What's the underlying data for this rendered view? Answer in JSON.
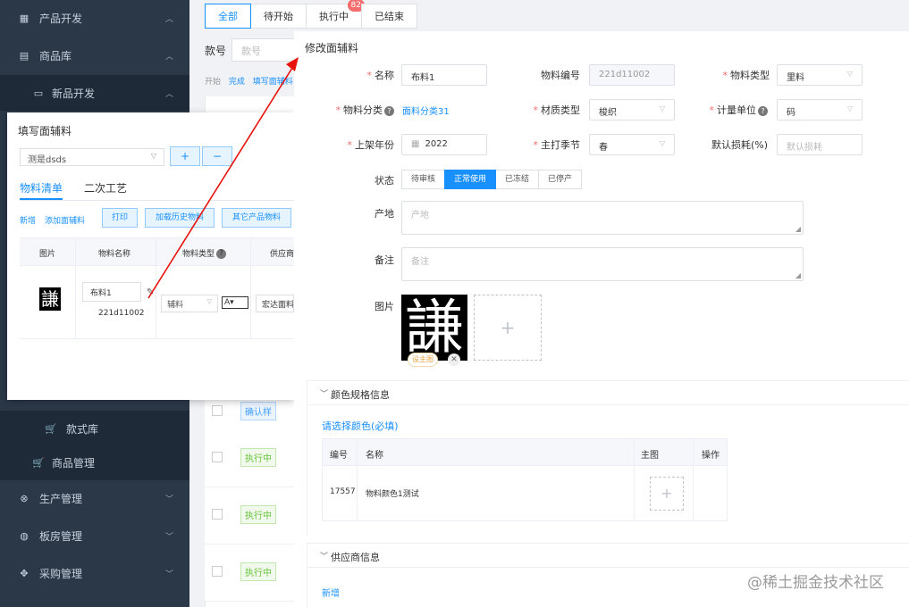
{
  "sidebar": {
    "items": [
      {
        "label": "产品开发",
        "icon": "grid-icon"
      },
      {
        "label": "商品库",
        "icon": "database-icon"
      },
      {
        "label": "新品开发",
        "icon": "card-icon"
      },
      {
        "label": "款式库",
        "icon": "cart-icon"
      },
      {
        "label": "商品管理",
        "icon": "cart-icon"
      },
      {
        "label": "生产管理",
        "icon": "target-icon"
      },
      {
        "label": "板房管理",
        "icon": "globe-icon"
      },
      {
        "label": "采购管理",
        "icon": "move-icon"
      }
    ]
  },
  "background_page": {
    "tabs": [
      "全部",
      "待开始",
      "执行中",
      "已结束"
    ],
    "badge": "82",
    "style_label": "款号",
    "style_placeholder": "款号",
    "status_links": [
      "开始",
      "完成",
      "填写面辅料"
    ],
    "row_status": [
      "确认样",
      "执行中",
      "执行中",
      "执行中"
    ]
  },
  "fill_dialog": {
    "title": "填写面辅料",
    "select_value": "测是dsds",
    "add_label": "+",
    "remove_label": "−",
    "tabs": [
      "物料清单",
      "二次工艺"
    ],
    "links": [
      "新增",
      "添加面辅料"
    ],
    "buttons": [
      "打印",
      "加载历史物料",
      "其它产品物料"
    ],
    "columns": [
      "图片",
      "物料名称",
      "物料类型",
      "供应商"
    ],
    "row": {
      "image_char": "謙",
      "name": "布料1",
      "code": "221d11002",
      "type": "辅料",
      "grade": "A",
      "supplier": "宏达面料"
    }
  },
  "edit_dialog": {
    "title": "修改面辅料",
    "fields": {
      "name_label": "名称",
      "name_value": "布料1",
      "code_label": "物料编号",
      "code_value": "221d11002",
      "mtype_label": "物料类型",
      "mtype_value": "里料",
      "category_label": "物料分类",
      "category_value": "面料分类31",
      "material_label": "材质类型",
      "material_value": "梭织",
      "unit_label": "计量单位",
      "unit_value": "码",
      "year_label": "上架年份",
      "year_value": "2022",
      "season_label": "主打季节",
      "season_value": "春",
      "loss_label": "默认损耗(%)",
      "loss_placeholder": "默认损耗",
      "status_label": "状态",
      "status_options": [
        "待审核",
        "正常使用",
        "已冻结",
        "已停产"
      ],
      "origin_label": "产地",
      "origin_placeholder": "产地",
      "remark_label": "备注",
      "remark_placeholder": "备注",
      "image_label": "图片",
      "image_char": "謙",
      "set_main_label": "设主图"
    },
    "color_section": {
      "title": "颜色规格信息",
      "select_link": "请选择颜色(必填)",
      "columns": [
        "编号",
        "名称",
        "主图",
        "操作"
      ],
      "rows": [
        {
          "code": "17557",
          "name": "物料颜色1测试"
        }
      ]
    },
    "supplier_section": {
      "title": "供应商信息",
      "add_link": "新增"
    }
  },
  "watermark": "@稀土掘金技术社区",
  "colors": {
    "accent": "#1890ff",
    "sidebar": "#2b3848",
    "required": "#f56c6c",
    "arrow": "#e8120c"
  }
}
